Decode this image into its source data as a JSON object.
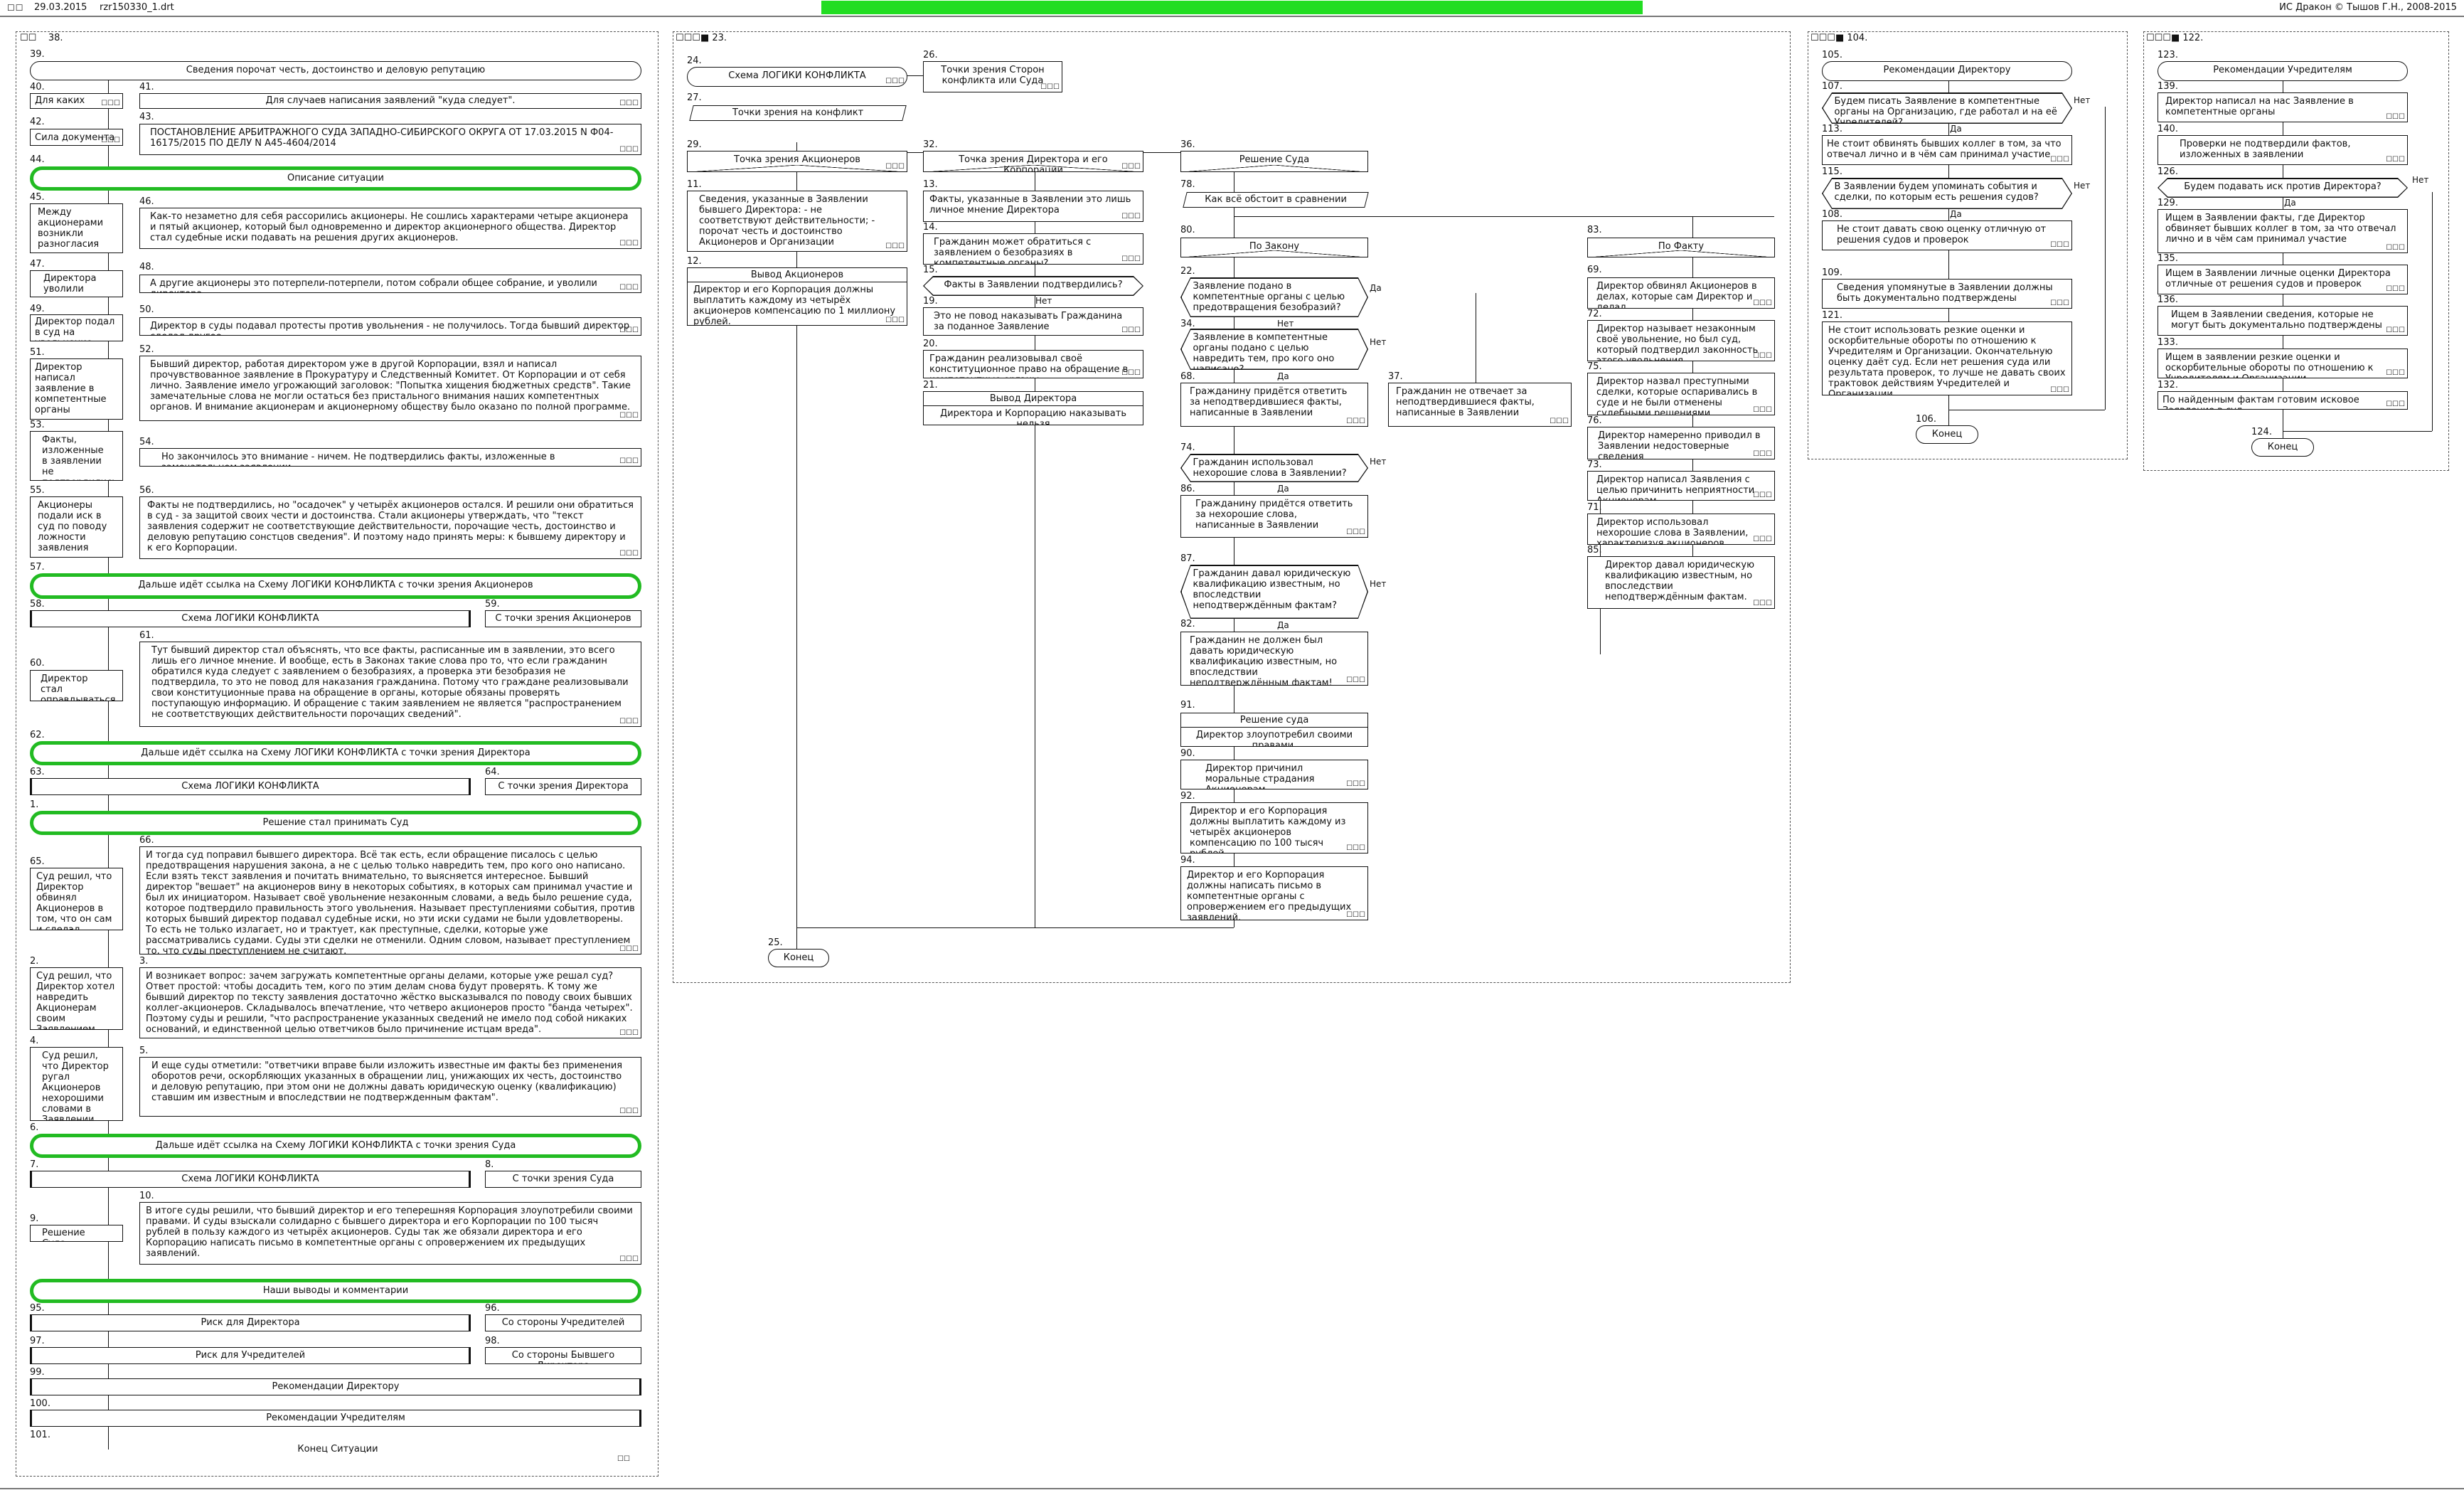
{
  "topbar": {
    "squares": "☐☐",
    "date": "29.03.2015",
    "file": "rzr150330_1.drt",
    "copyright": "ИС Дракон © Тышов Г.Н., 2008-2015"
  },
  "yes": "Да",
  "no": "Нет",
  "sq": "☐☐☐",
  "p1": {
    "num": "38.",
    "title_n": "39.",
    "title": "Сведения порочат честь, достоинство и деловую репутацию",
    "rows": [
      {
        "ln": "40.",
        "l": "Для каких случаев",
        "rn": "41.",
        "r": "Для случаев написания заявлений \"куда следует\"."
      },
      {
        "ln": "42.",
        "l": "Сила документа",
        "rn": "43.",
        "r": "ПОСТАНОВЛЕНИЕ АРБИТРАЖНОГО СУДА ЗАПАДНО-СИБИРСКОГО ОКРУГА ОТ 17.03.2015 N Ф04-16175/2015 ПО ДЕЛУ N А45-4604/2014"
      }
    ],
    "g44n": "44.",
    "g44": "Описание ситуации",
    "rows2": [
      {
        "ln": "45.",
        "l": "Между акционерами возникли разногласия",
        "rn": "46.",
        "r": "Как-то незаметно для себя рассорились акционеры. Не сошлись характерами четыре акционера и пятый акционер, который был одновременно и директор акционерного общества. Директор стал судебные иски подавать на решения других акционеров."
      },
      {
        "ln": "47.",
        "l": "Директора уволили",
        "rn": "48.",
        "r": "А другие акционеры это потерпели-потерпели, потом собрали общее собрание, и уволили директора."
      },
      {
        "ln": "49.",
        "l": "Директор подал в суд на увольнение",
        "rn": "50.",
        "r": "Директор в суды подавал протесты против увольнения - не получилось. Тогда бывший директор сделал другое."
      },
      {
        "ln": "51.",
        "l": "Директор написал заявление в компетентные органы",
        "rn": "52.",
        "r": "Бывший директор, работая директором уже в другой Корпорации, взял и написал прочувствованное заявление в Прокуратуру и Следственный Комитет. От Корпорации и от себя лично. Заявление имело угрожающий заголовок: \"Попытка хищения бюджетных средств\". Такие замечательные слова не могли остаться без пристального внимания наших компетентных органов. И внимание акционерам и акционерному обществу было оказано по полной программе."
      },
      {
        "ln": "53.",
        "l": "Факты, изложенные в заявлении не подтвердились",
        "rn": "54.",
        "r": "Но закончилось это внимание - ничем. Не подтвердились факты, изложенные в замечательном заявлении."
      },
      {
        "ln": "55.",
        "l": "Акционеры подали иск в суд по поводу ложности заявления",
        "rn": "56.",
        "r": "Факты не подтвердились, но \"осадочек\" у четырёх акционеров остался. И решили они обратиться в суд - за защитой своих чести и достоинства. Стали акционеры утверждать, что \"текст заявления содержит не соответствующие действительности, порочащие честь, достоинство и деловую репутацию сонстцов сведения\". И поэтому надо принять меры: к бывшему директору и к его Корпорации."
      }
    ],
    "g57n": "57.",
    "g57": "Дальше идёт ссылка на Схему ЛОГИКИ КОНФЛИКТА с точки зрения Акционеров",
    "s58n": "58.",
    "s58": "Схема ЛОГИКИ КОНФЛИКТА",
    "s59n": "59.",
    "s59": "С точки зрения Акционеров",
    "c60n": "60.",
    "c60": "Директор стал оправдываться",
    "c61n": "61.",
    "c61": "Тут бывший директор стал объяснять, что все факты, расписанные им в заявлении, это всего лишь его личное мнение. И вообще, есть в Законах такие слова про то, что если гражданин обратился куда следует с заявлением о безобразиях, а проверка эти безобразия не подтвердила, то это не повод для наказания гражданина. Потому что граждане реализовывали свои конституционные права на обращение в органы, которые обязаны проверять поступающую информацию. И обращение с таким заявлением не является \"распространением не соответствующих действительности порочащих сведений\".",
    "g62n": "62.",
    "g62": "Дальше идёт ссылка на Схему ЛОГИКИ КОНФЛИКТА с точки зрения Директора",
    "s63n": "63.",
    "s63": "Схема ЛОГИКИ КОНФЛИКТА",
    "s64n": "64.",
    "s64": "С точки зрения Директора",
    "g1n": "1.",
    "g1": "Решение стал принимать Суд",
    "c65n": "65.",
    "c65": "Суд решил, что Директор обвинял Акционеров в том, что он сам и сделал",
    "c66n": "66.",
    "c66": "И тогда суд поправил бывшего директора. Всё так есть, если обращение писалось с целью предотвращения нарушения закона, а не с целью только навредить тем, про кого оно написано. Если взять текст заявления и почитать внимательно, то выясняется интересное. Бывший директор \"вешает\" на акционеров вину в некоторых событиях, в которых сам принимал участие и был их инициатором. Называет своё увольнение незаконным словами, а ведь было решение суда, которое подтвердило правильность этого увольнения. Называет преступлениями события, против которых бывший директор подавал судебные иски, но эти иски судами не были удовлетворены. То есть не только излагает, но и трактует, как преступные, сделки, которые уже рассматривались судами. Суды эти сделки не отменили. Одним словом, называет преступлением то, что суды преступлением не считают.",
    "c2n": "2.",
    "c2": "Суд решил, что Директор хотел навредить Акционерам своим Заявлением",
    "c3n": "3.",
    "c3": "И возникает вопрос: зачем загружать компетентные органы делами, которые уже решал суд? Ответ простой: чтобы досадить тем, кого по этим делам снова будут проверять. К тому же бывший директор по тексту заявления достаточно жёстко высказывался по поводу своих бывших коллег-акционеров. Складывалось впечатление, что четверо акционеров просто \"банда четырех\". Поэтому суды и решили, \"что распространение указанных сведений не имело под собой никаких оснований, и единственной целью ответчиков было причинение истцам вреда\".",
    "c4n": "4.",
    "c4": "Суд решил, что Директор ругал Акционеров нехорошими словами в Заявлении",
    "c5n": "5.",
    "c5": "И еще суды отметили: \"ответчики вправе были изложить известные им факты без применения оборотов речи, оскорбляющих указанных в обращении лиц, унижающих их честь, достоинство и деловую репутацию, при этом они не должны давать юридическую оценку (квалификацию) ставшим им известным и впоследствии не подтвержденным фактам\".",
    "g6n": "6.",
    "g6": "Дальше идёт ссылка на Схему ЛОГИКИ КОНФЛИКТА с точки зрения Суда",
    "s7n": "7.",
    "s7": "Схема ЛОГИКИ КОНФЛИКТА",
    "s8n": "8.",
    "s8": "С точки зрения Суда",
    "c9n": "9.",
    "c9": "Решение Суда",
    "c10n": "10.",
    "c10": "В итоге суды решили, что бывший директор и его теперешняя Корпорация злоупотребили своими правами. И суды взыскали солидарно с бывшего директора и его Корпорации по 100 тысяч рублей в пользу каждого из четырёх акционеров. Суды так же обязали директора и его Корпорацию написать письмо в компетентные органы с опровержением их предыдущих заявлений.",
    "g11": "Наши выводы и комментарии",
    "s95n": "95.",
    "s95": "Риск для Директора",
    "s96n": "96.",
    "s96": "Со стороны Учредителей",
    "s97n": "97.",
    "s97": "Риск для Учредителей",
    "s98n": "98.",
    "s98": "Со стороны Бывшего Директора",
    "s99n": "99.",
    "s99": "Рекомендации Директору",
    "s100n": "100.",
    "s100": "Рекомендации Учредителям",
    "e101n": "101.",
    "e101": "Конец Ситуации"
  },
  "p2": {
    "num": "23.",
    "t24n": "24.",
    "t24": "Схема ЛОГИКИ КОНФЛИКТА",
    "c26n": "26.",
    "c26": "Точки зрения Сторон конфликта или Суда",
    "l27n": "27.",
    "l27": "Точки зрения на конфликт",
    "h29n": "29.",
    "h29": "Точка зрения Акционеров",
    "h32n": "32.",
    "h32": "Точка зрения Директора и его Корпорации",
    "h36n": "36.",
    "h36": "Решение Суда",
    "a11n": "11.",
    "a11": "Сведения, указанные в Заявлении бывшего Директора: - не соответствуют действительности; - порочат честь и достоинство Акционеров и Организации",
    "a12n": "12.",
    "a12t": "Вывод Акционеров",
    "a12": "Директор и его Корпорация должны выплатить каждому из четырёх акционеров компенсацию по 1 миллиону рублей.",
    "a13n": "13.",
    "a13": "Факты, указанные в Заявлении это лишь личное мнение Директора",
    "a14n": "14.",
    "a14": "Гражданин может обратиться с заявлением о безобразиях в компетентные органы?",
    "a15n": "15.",
    "a15": "Факты в Заявлении подтвердились?",
    "a19n": "19.",
    "a19": "Это не повод наказывать Гражданина за поданное Заявление",
    "a20n": "20.",
    "a20": "Гражданин реализовывал своё конституционное право на обращение в компетентные органы",
    "a21n": "21.",
    "a21t": "Вывод Директора",
    "a21": "Директора и Корпорацию наказывать нельзя",
    "a78n": "78.",
    "a78": "Как всё обстоит в сравнении",
    "a80n": "80.",
    "a80": "По Закону",
    "a83n": "83.",
    "a83": "По Факту",
    "a22n": "22.",
    "a22": "Заявление подано в компетентные органы с целью предотвращения безобразий?",
    "a34n": "34.",
    "a34": "Заявление в компетентные органы подано с целью навредить тем, про кого оно написано?",
    "a68n": "68.",
    "a68": "Гражданину придётся ответить за неподтвердившиеся факты, написанные в Заявлении",
    "a37n": "37.",
    "a37": "Гражданин не отвечает за неподтвердившиеся факты, написанные в Заявлении",
    "a74n": "74.",
    "a74": "Гражданин использовал нехорошие слова в Заявлении?",
    "a86n": "86.",
    "a86": "Гражданину придётся ответить за нехорошие слова, написанные в Заявлении",
    "a87n": "87.",
    "a87": "Гражданин давал юридическую квалификацию известным, но впоследствии неподтверждённым фактам?",
    "a82n": "82.",
    "a82": "Гражданин не должен был давать юридическую квалификацию известным, но впоследствии неподтверждённым фактам!",
    "a91n": "91.",
    "a91t": "Решение суда",
    "a91": "Директор злоупотребил своими правами.",
    "a90n": "90.",
    "a90": "Директор причинил моральные страдания Акционерам",
    "a92n": "92.",
    "a92": "Директор и его Корпорация должны выплатить каждому из четырёх акционеров компенсацию по 100 тысяч рублей.",
    "a94n": "94.",
    "a94": "Директор и его Корпорация должны написать письмо в компетентные органы с опровержением его предыдущих заявлений.",
    "f69n": "69.",
    "f69": "Директор обвинял Акционеров в делах, которые сам Директор и делал",
    "f72n": "72.",
    "f72": "Директор называет незаконным своё увольнение, но был суд, который подтвердил законность этого увольнения",
    "f75n": "75.",
    "f75": "Директор назвал преступными сделки, которые оспаривались в суде и не были отменены судебными решениями",
    "f76n": "76.",
    "f76": "Директор намеренно приводил в Заявлении недостоверные сведения",
    "f73n": "73.",
    "f73": "Директор написал Заявления с целью причинить неприятности Акционерам",
    "f71n": "71.",
    "f71": "Директор использовал нехорошие слова в Заявлении, характеризуя акционеров",
    "f85n": "85.",
    "f85": "Директор давал юридическую квалификацию известным, но впоследствии неподтверждённым фактам.",
    "e25n": "25.",
    "e25": "Конец"
  },
  "p3": {
    "num": "104.",
    "t105n": "105.",
    "t105": "Рекомендации Директору",
    "q107n": "107.",
    "q107": "Будем писать Заявление в компетентные органы на Организацию, где работал и на её Учредителей?",
    "a113n": "113.",
    "a113": "Не стоит обвинять бывших коллег в том, за что отвечал лично и в чём сам принимал участие",
    "q115n": "115.",
    "q115": "В Заявлении будем упоминать события и сделки, по которым есть решения судов?",
    "a108n": "108.",
    "a108": "Не стоит давать свою оценку отличную от решения судов и проверок",
    "a109n": "109.",
    "a109": "Сведения упомянутые в Заявлении должны быть документально подтверждены",
    "a121n": "121.",
    "a121": "Не стоит использовать резкие оценки и оскорбительные обороты по отношению к Учредителям и Организации. Окончательную оценку даёт суд. Если нет решения суда или результата проверок, то лучше не давать своих трактовок действиям Учредителей и Организации.",
    "e106n": "106.",
    "e106": "Конец"
  },
  "p4": {
    "num": "122.",
    "t123n": "123.",
    "t123": "Рекомендации Учредителям",
    "a139n": "139.",
    "a139": "Директор написал на нас Заявление в компетентные органы",
    "a140n": "140.",
    "a140": "Проверки не подтвердили фактов, изложенных в заявлении",
    "q126n": "126.",
    "q126": "Будем подавать иск против Директора?",
    "a129n": "129.",
    "a129": "Ищем в Заявлении факты, где Директор обвиняет бывших коллег в том, за что отвечал лично и в чём сам принимал участие",
    "a135n": "135.",
    "a135": "Ищем в Заявлении личные оценки Директора отличные от решения судов и проверок",
    "a136n": "136.",
    "a136": "Ищем в Заявлении сведения, которые не могут быть документально подтверждены",
    "a133n": "133.",
    "a133": "Ищем в заявлении резкие оценки и оскорбительные обороты по отношению к Учредителям и Организации.",
    "a132n": "132.",
    "a132": "По найденным фактам готовим исковое Заявление в суд",
    "e124n": "124.",
    "e124": "Конец"
  }
}
